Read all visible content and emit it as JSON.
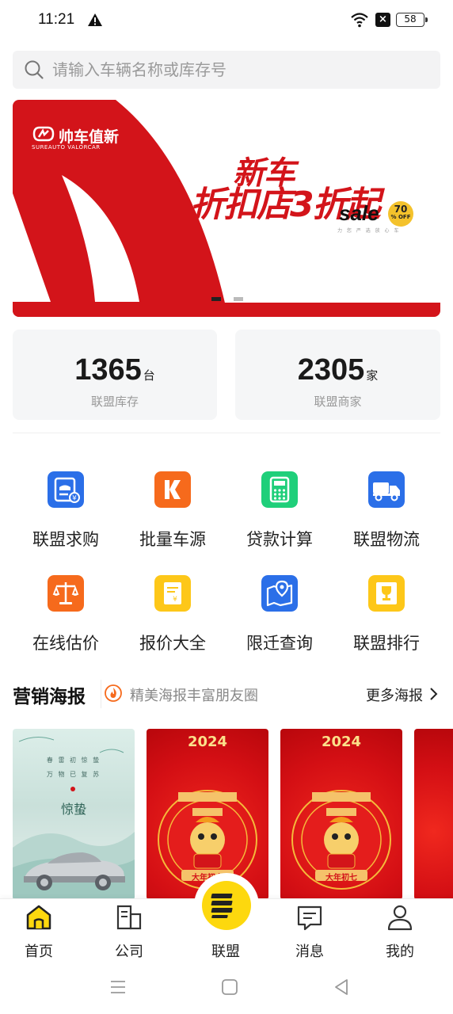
{
  "status_bar": {
    "time": "11:21",
    "battery": "58"
  },
  "search": {
    "placeholder": "请输入车辆名称或库存号"
  },
  "banner": {
    "brand_name": "帅车值新",
    "brand_sub": "SUREAUTO VALORCAR",
    "headline_1": "新车",
    "headline_2": "折扣店3折起",
    "sale": "sale",
    "badge_num": "70",
    "badge_unit": "% OFF",
    "tagline": "力 您 严 选 放 心 车",
    "colors": {
      "red": "#d3141a",
      "badge": "#f4c22c"
    }
  },
  "stats": [
    {
      "value": "1365",
      "unit": "台",
      "label": "联盟库存"
    },
    {
      "value": "2305",
      "unit": "家",
      "label": "联盟商家"
    }
  ],
  "features": [
    {
      "label": "联盟求购",
      "icon": "purchase-request-icon",
      "color": "#2b6fe8"
    },
    {
      "label": "批量车源",
      "icon": "bulk-source-icon",
      "color": "#f66a1c"
    },
    {
      "label": "贷款计算",
      "icon": "calculator-icon",
      "color": "#1fcf7a"
    },
    {
      "label": "联盟物流",
      "icon": "truck-icon",
      "color": "#2b6fe8"
    },
    {
      "label": "在线估价",
      "icon": "scale-icon",
      "color": "#f66a1c"
    },
    {
      "label": "报价大全",
      "icon": "price-list-icon",
      "color": "#fdc719"
    },
    {
      "label": "限迁查询",
      "icon": "map-location-icon",
      "color": "#2b6fe8"
    },
    {
      "label": "联盟排行",
      "icon": "trophy-icon",
      "color": "#fdc719"
    }
  ],
  "marketing": {
    "title": "营销海报",
    "subtitle": "精美海报丰富朋友圈",
    "more": "更多海报"
  },
  "posters": [
    {
      "kind": "jingzhe",
      "lines": [
        "春 雷 初 惊 蛰",
        "万 物 已 复 苏"
      ],
      "title": "惊蛰"
    },
    {
      "kind": "new-year",
      "year": "2024",
      "caption": "大年初六"
    },
    {
      "kind": "new-year",
      "year": "2024",
      "caption": "大年初七"
    }
  ],
  "bottom_nav": [
    {
      "label": "首页",
      "icon": "home-icon"
    },
    {
      "label": "公司",
      "icon": "company-icon"
    },
    {
      "label": "联盟",
      "icon": "alliance-icon"
    },
    {
      "label": "消息",
      "icon": "message-icon"
    },
    {
      "label": "我的",
      "icon": "profile-icon"
    }
  ]
}
